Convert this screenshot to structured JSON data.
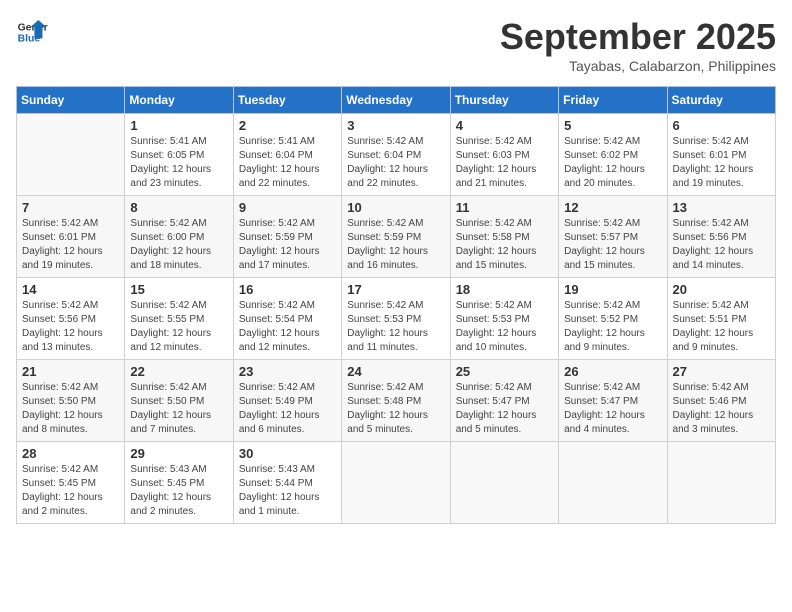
{
  "header": {
    "logo_line1": "General",
    "logo_line2": "Blue",
    "month": "September 2025",
    "location": "Tayabas, Calabarzon, Philippines"
  },
  "days_of_week": [
    "Sunday",
    "Monday",
    "Tuesday",
    "Wednesday",
    "Thursday",
    "Friday",
    "Saturday"
  ],
  "weeks": [
    [
      null,
      {
        "day": 1,
        "sunrise": "5:41 AM",
        "sunset": "6:05 PM",
        "daylight": "12 hours and 23 minutes."
      },
      {
        "day": 2,
        "sunrise": "5:41 AM",
        "sunset": "6:04 PM",
        "daylight": "12 hours and 22 minutes."
      },
      {
        "day": 3,
        "sunrise": "5:42 AM",
        "sunset": "6:04 PM",
        "daylight": "12 hours and 22 minutes."
      },
      {
        "day": 4,
        "sunrise": "5:42 AM",
        "sunset": "6:03 PM",
        "daylight": "12 hours and 21 minutes."
      },
      {
        "day": 5,
        "sunrise": "5:42 AM",
        "sunset": "6:02 PM",
        "daylight": "12 hours and 20 minutes."
      },
      {
        "day": 6,
        "sunrise": "5:42 AM",
        "sunset": "6:01 PM",
        "daylight": "12 hours and 19 minutes."
      }
    ],
    [
      {
        "day": 7,
        "sunrise": "5:42 AM",
        "sunset": "6:01 PM",
        "daylight": "12 hours and 19 minutes."
      },
      {
        "day": 8,
        "sunrise": "5:42 AM",
        "sunset": "6:00 PM",
        "daylight": "12 hours and 18 minutes."
      },
      {
        "day": 9,
        "sunrise": "5:42 AM",
        "sunset": "5:59 PM",
        "daylight": "12 hours and 17 minutes."
      },
      {
        "day": 10,
        "sunrise": "5:42 AM",
        "sunset": "5:59 PM",
        "daylight": "12 hours and 16 minutes."
      },
      {
        "day": 11,
        "sunrise": "5:42 AM",
        "sunset": "5:58 PM",
        "daylight": "12 hours and 15 minutes."
      },
      {
        "day": 12,
        "sunrise": "5:42 AM",
        "sunset": "5:57 PM",
        "daylight": "12 hours and 15 minutes."
      },
      {
        "day": 13,
        "sunrise": "5:42 AM",
        "sunset": "5:56 PM",
        "daylight": "12 hours and 14 minutes."
      }
    ],
    [
      {
        "day": 14,
        "sunrise": "5:42 AM",
        "sunset": "5:56 PM",
        "daylight": "12 hours and 13 minutes."
      },
      {
        "day": 15,
        "sunrise": "5:42 AM",
        "sunset": "5:55 PM",
        "daylight": "12 hours and 12 minutes."
      },
      {
        "day": 16,
        "sunrise": "5:42 AM",
        "sunset": "5:54 PM",
        "daylight": "12 hours and 12 minutes."
      },
      {
        "day": 17,
        "sunrise": "5:42 AM",
        "sunset": "5:53 PM",
        "daylight": "12 hours and 11 minutes."
      },
      {
        "day": 18,
        "sunrise": "5:42 AM",
        "sunset": "5:53 PM",
        "daylight": "12 hours and 10 minutes."
      },
      {
        "day": 19,
        "sunrise": "5:42 AM",
        "sunset": "5:52 PM",
        "daylight": "12 hours and 9 minutes."
      },
      {
        "day": 20,
        "sunrise": "5:42 AM",
        "sunset": "5:51 PM",
        "daylight": "12 hours and 9 minutes."
      }
    ],
    [
      {
        "day": 21,
        "sunrise": "5:42 AM",
        "sunset": "5:50 PM",
        "daylight": "12 hours and 8 minutes."
      },
      {
        "day": 22,
        "sunrise": "5:42 AM",
        "sunset": "5:50 PM",
        "daylight": "12 hours and 7 minutes."
      },
      {
        "day": 23,
        "sunrise": "5:42 AM",
        "sunset": "5:49 PM",
        "daylight": "12 hours and 6 minutes."
      },
      {
        "day": 24,
        "sunrise": "5:42 AM",
        "sunset": "5:48 PM",
        "daylight": "12 hours and 5 minutes."
      },
      {
        "day": 25,
        "sunrise": "5:42 AM",
        "sunset": "5:47 PM",
        "daylight": "12 hours and 5 minutes."
      },
      {
        "day": 26,
        "sunrise": "5:42 AM",
        "sunset": "5:47 PM",
        "daylight": "12 hours and 4 minutes."
      },
      {
        "day": 27,
        "sunrise": "5:42 AM",
        "sunset": "5:46 PM",
        "daylight": "12 hours and 3 minutes."
      }
    ],
    [
      {
        "day": 28,
        "sunrise": "5:42 AM",
        "sunset": "5:45 PM",
        "daylight": "12 hours and 2 minutes."
      },
      {
        "day": 29,
        "sunrise": "5:43 AM",
        "sunset": "5:45 PM",
        "daylight": "12 hours and 2 minutes."
      },
      {
        "day": 30,
        "sunrise": "5:43 AM",
        "sunset": "5:44 PM",
        "daylight": "12 hours and 1 minute."
      },
      null,
      null,
      null,
      null
    ]
  ]
}
